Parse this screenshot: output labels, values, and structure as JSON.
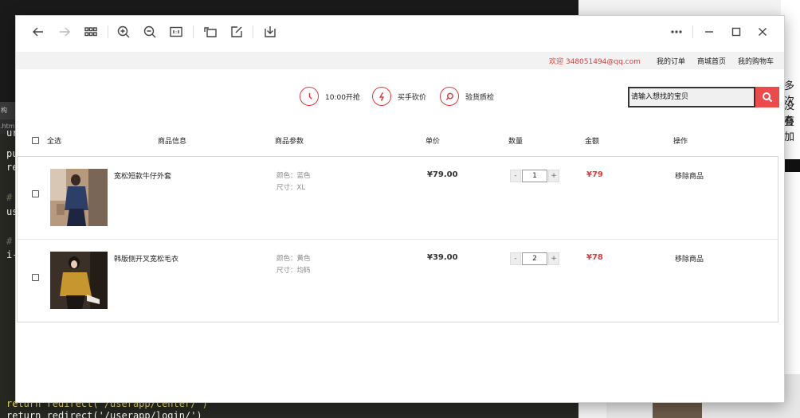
{
  "background_editor": {
    "tab_label": "构(H)",
    "file_tab": ".html",
    "code_lines": [
      {
        "text": "ur",
        "comment": false
      },
      {
        "text": "pu",
        "comment": false
      },
      {
        "text": "re",
        "comment": false
      },
      {
        "text": "#",
        "comment": true
      },
      {
        "text": "us",
        "comment": false
      },
      {
        "text": "#",
        "comment": true
      },
      {
        "text": "i-",
        "comment": false
      },
      {
        "text": "    return redirect('/userapp/center/')",
        "comment": false
      },
      {
        "text": "return redirect('/userapp/login/')",
        "comment": false
      }
    ]
  },
  "background_right": {
    "snippets": [
      "多次",
      "没有",
      "叠加"
    ]
  },
  "page": {
    "topbar": {
      "welcome": "欢迎 348051494@qq.com",
      "links": [
        "我的订单",
        "商城首页",
        "我的购物车"
      ]
    },
    "features": [
      {
        "icon": "clock-icon",
        "label": "10:00开抢"
      },
      {
        "icon": "lightning-icon",
        "label": "买手砍价"
      },
      {
        "icon": "magnifier-icon",
        "label": "验货质检"
      }
    ],
    "search": {
      "value": "请输入想找的宝贝"
    },
    "table_headers": {
      "select_all": "全选",
      "info": "商品信息",
      "params": "商品参数",
      "unit_price": "单价",
      "quantity": "数量",
      "amount": "金额",
      "action": "操作"
    },
    "items": [
      {
        "name": "宽松短款牛仔外套",
        "color": "颜色：蓝色",
        "size": "尺寸：XL",
        "price": "¥79.00",
        "quantity": "1",
        "total": "¥79",
        "remove": "移除商品",
        "minus": "-",
        "plus": "+"
      },
      {
        "name": "韩版侧开叉宽松毛衣",
        "color": "颜色：黄色",
        "size": "尺寸：均码",
        "price": "¥39.00",
        "quantity": "2",
        "total": "¥78",
        "remove": "移除商品",
        "minus": "-",
        "plus": "+"
      }
    ]
  },
  "colors": {
    "accent": "#e4393c",
    "search_button": "#ec4b4b",
    "topbar_bg": "#f2f2f2"
  }
}
